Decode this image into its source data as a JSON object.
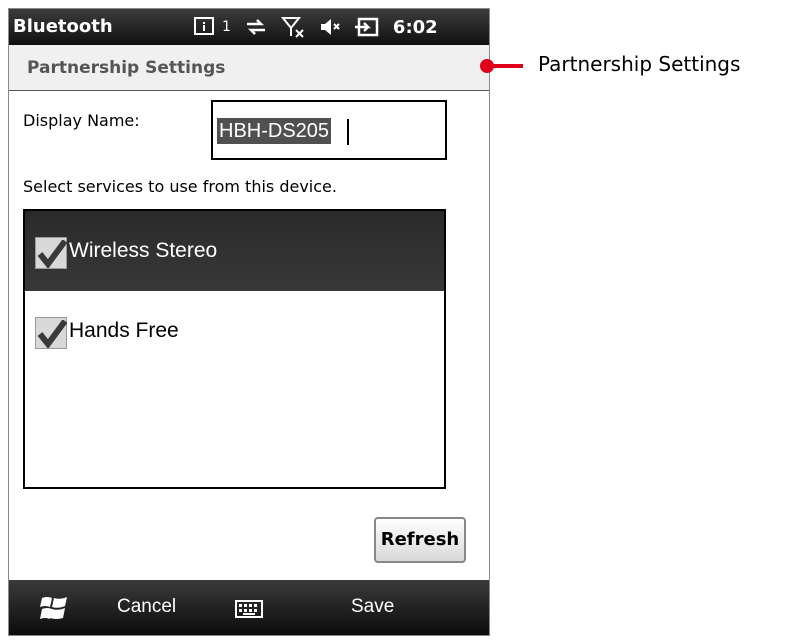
{
  "status_bar": {
    "title": "Bluetooth",
    "notification_count": "1",
    "time": "6:02"
  },
  "header": {
    "title": "Partnership Settings"
  },
  "form": {
    "display_name_label": "Display Name:",
    "display_name_value": "HBH-DS205",
    "services_prompt": "Select services to use from this device.",
    "services": [
      {
        "label": "Wireless Stereo",
        "checked": true,
        "selected": true
      },
      {
        "label": "Hands Free",
        "checked": true,
        "selected": false
      }
    ],
    "refresh_label": "Refresh"
  },
  "soft_keys": {
    "left": "Cancel",
    "right": "Save"
  },
  "callout": {
    "label": "Partnership Settings",
    "color": "#e0001b"
  }
}
